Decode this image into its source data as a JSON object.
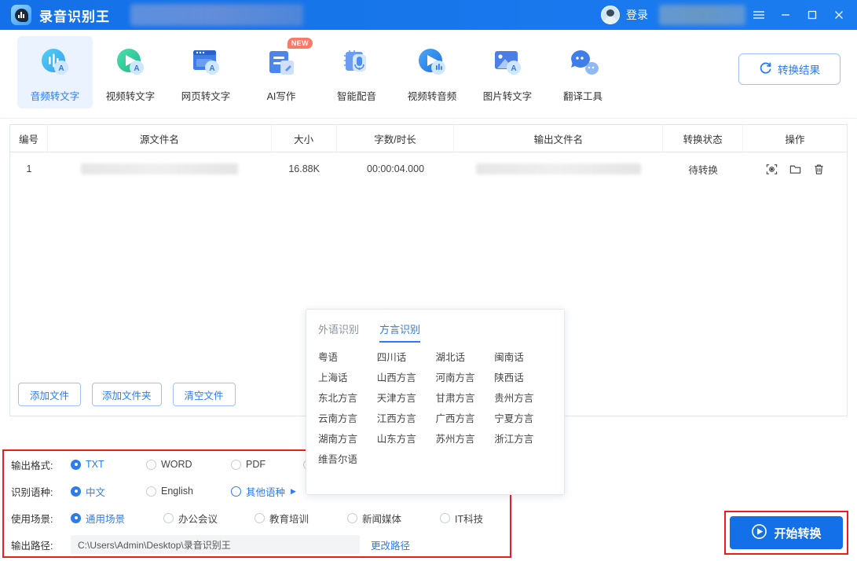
{
  "titlebar": {
    "app_name": "录音识别王",
    "login_label": "登录",
    "logo_icon": "audio-waveform-bubble-icon",
    "menu_icon": "hamburger-menu-icon",
    "minimize_icon": "minimize-icon",
    "maximize_icon": "maximize-icon",
    "close_icon": "close-icon",
    "brand_color": "#1470e8"
  },
  "toolbar": {
    "items": [
      {
        "label": "音频转文字",
        "icon": "audio-to-text-icon",
        "active": true,
        "badge": ""
      },
      {
        "label": "视频转文字",
        "icon": "video-to-text-icon",
        "active": false,
        "badge": ""
      },
      {
        "label": "网页转文字",
        "icon": "webpage-to-text-icon",
        "active": false,
        "badge": ""
      },
      {
        "label": "AI写作",
        "icon": "ai-writing-icon",
        "active": false,
        "badge": "NEW"
      },
      {
        "label": "智能配音",
        "icon": "smart-dubbing-icon",
        "active": false,
        "badge": ""
      },
      {
        "label": "视频转音频",
        "icon": "video-to-audio-icon",
        "active": false,
        "badge": ""
      },
      {
        "label": "图片转文字",
        "icon": "image-to-text-icon",
        "active": false,
        "badge": ""
      },
      {
        "label": "翻译工具",
        "icon": "translate-tool-icon",
        "active": false,
        "badge": ""
      }
    ],
    "result_button": {
      "label": "转换结果",
      "icon": "refresh-circle-icon"
    }
  },
  "table": {
    "headers": [
      "编号",
      "源文件名",
      "大小",
      "字数/时长",
      "输出文件名",
      "转换状态",
      "操作"
    ],
    "rows": [
      {
        "index": "1",
        "source_name": "",
        "size": "16.88K",
        "duration": "00:00:04.000",
        "output_name": "",
        "status": "待转换",
        "actions": [
          "preview-icon",
          "open-folder-icon",
          "delete-icon"
        ]
      }
    ],
    "buttons": {
      "add_file": "添加文件",
      "add_folder": "添加文件夹",
      "clear_files": "清空文件"
    }
  },
  "settings": {
    "output_format": {
      "label": "输出格式:",
      "options": [
        {
          "label": "TXT",
          "selected": true
        },
        {
          "label": "WORD",
          "selected": false
        },
        {
          "label": "PDF",
          "selected": false
        },
        {
          "label": "",
          "selected": false
        }
      ]
    },
    "language": {
      "label": "识别语种:",
      "options": [
        {
          "label": "中文",
          "selected": true,
          "hover": false,
          "arrow": false
        },
        {
          "label": "English",
          "selected": false,
          "hover": false,
          "arrow": false
        },
        {
          "label": "其他语种",
          "selected": false,
          "hover": true,
          "arrow": true
        }
      ]
    },
    "scenario": {
      "label": "使用场景:",
      "options": [
        {
          "label": "通用场景",
          "selected": true
        },
        {
          "label": "办公会议",
          "selected": false
        },
        {
          "label": "教育培训",
          "selected": false
        },
        {
          "label": "新闻媒体",
          "selected": false
        },
        {
          "label": "IT科技",
          "selected": false
        }
      ]
    },
    "output_path": {
      "label": "输出路径:",
      "value": "C:\\Users\\Admin\\Desktop\\录音识别王",
      "change_link": "更改路径"
    },
    "highlight_color": "#f01c1c"
  },
  "language_popup": {
    "tabs": [
      {
        "label": "外语识别",
        "active": false
      },
      {
        "label": "方言识别",
        "active": true
      }
    ],
    "dialects": [
      "粤语",
      "四川话",
      "湖北话",
      "闽南话",
      "上海话",
      "山西方言",
      "河南方言",
      "陕西话",
      "东北方言",
      "天津方言",
      "甘肃方言",
      "贵州方言",
      "云南方言",
      "江西方言",
      "广西方言",
      "宁夏方言",
      "湖南方言",
      "山东方言",
      "苏州方言",
      "浙江方言",
      "维吾尔语"
    ]
  },
  "start_button": {
    "label": "开始转换",
    "icon": "play-circle-icon"
  }
}
